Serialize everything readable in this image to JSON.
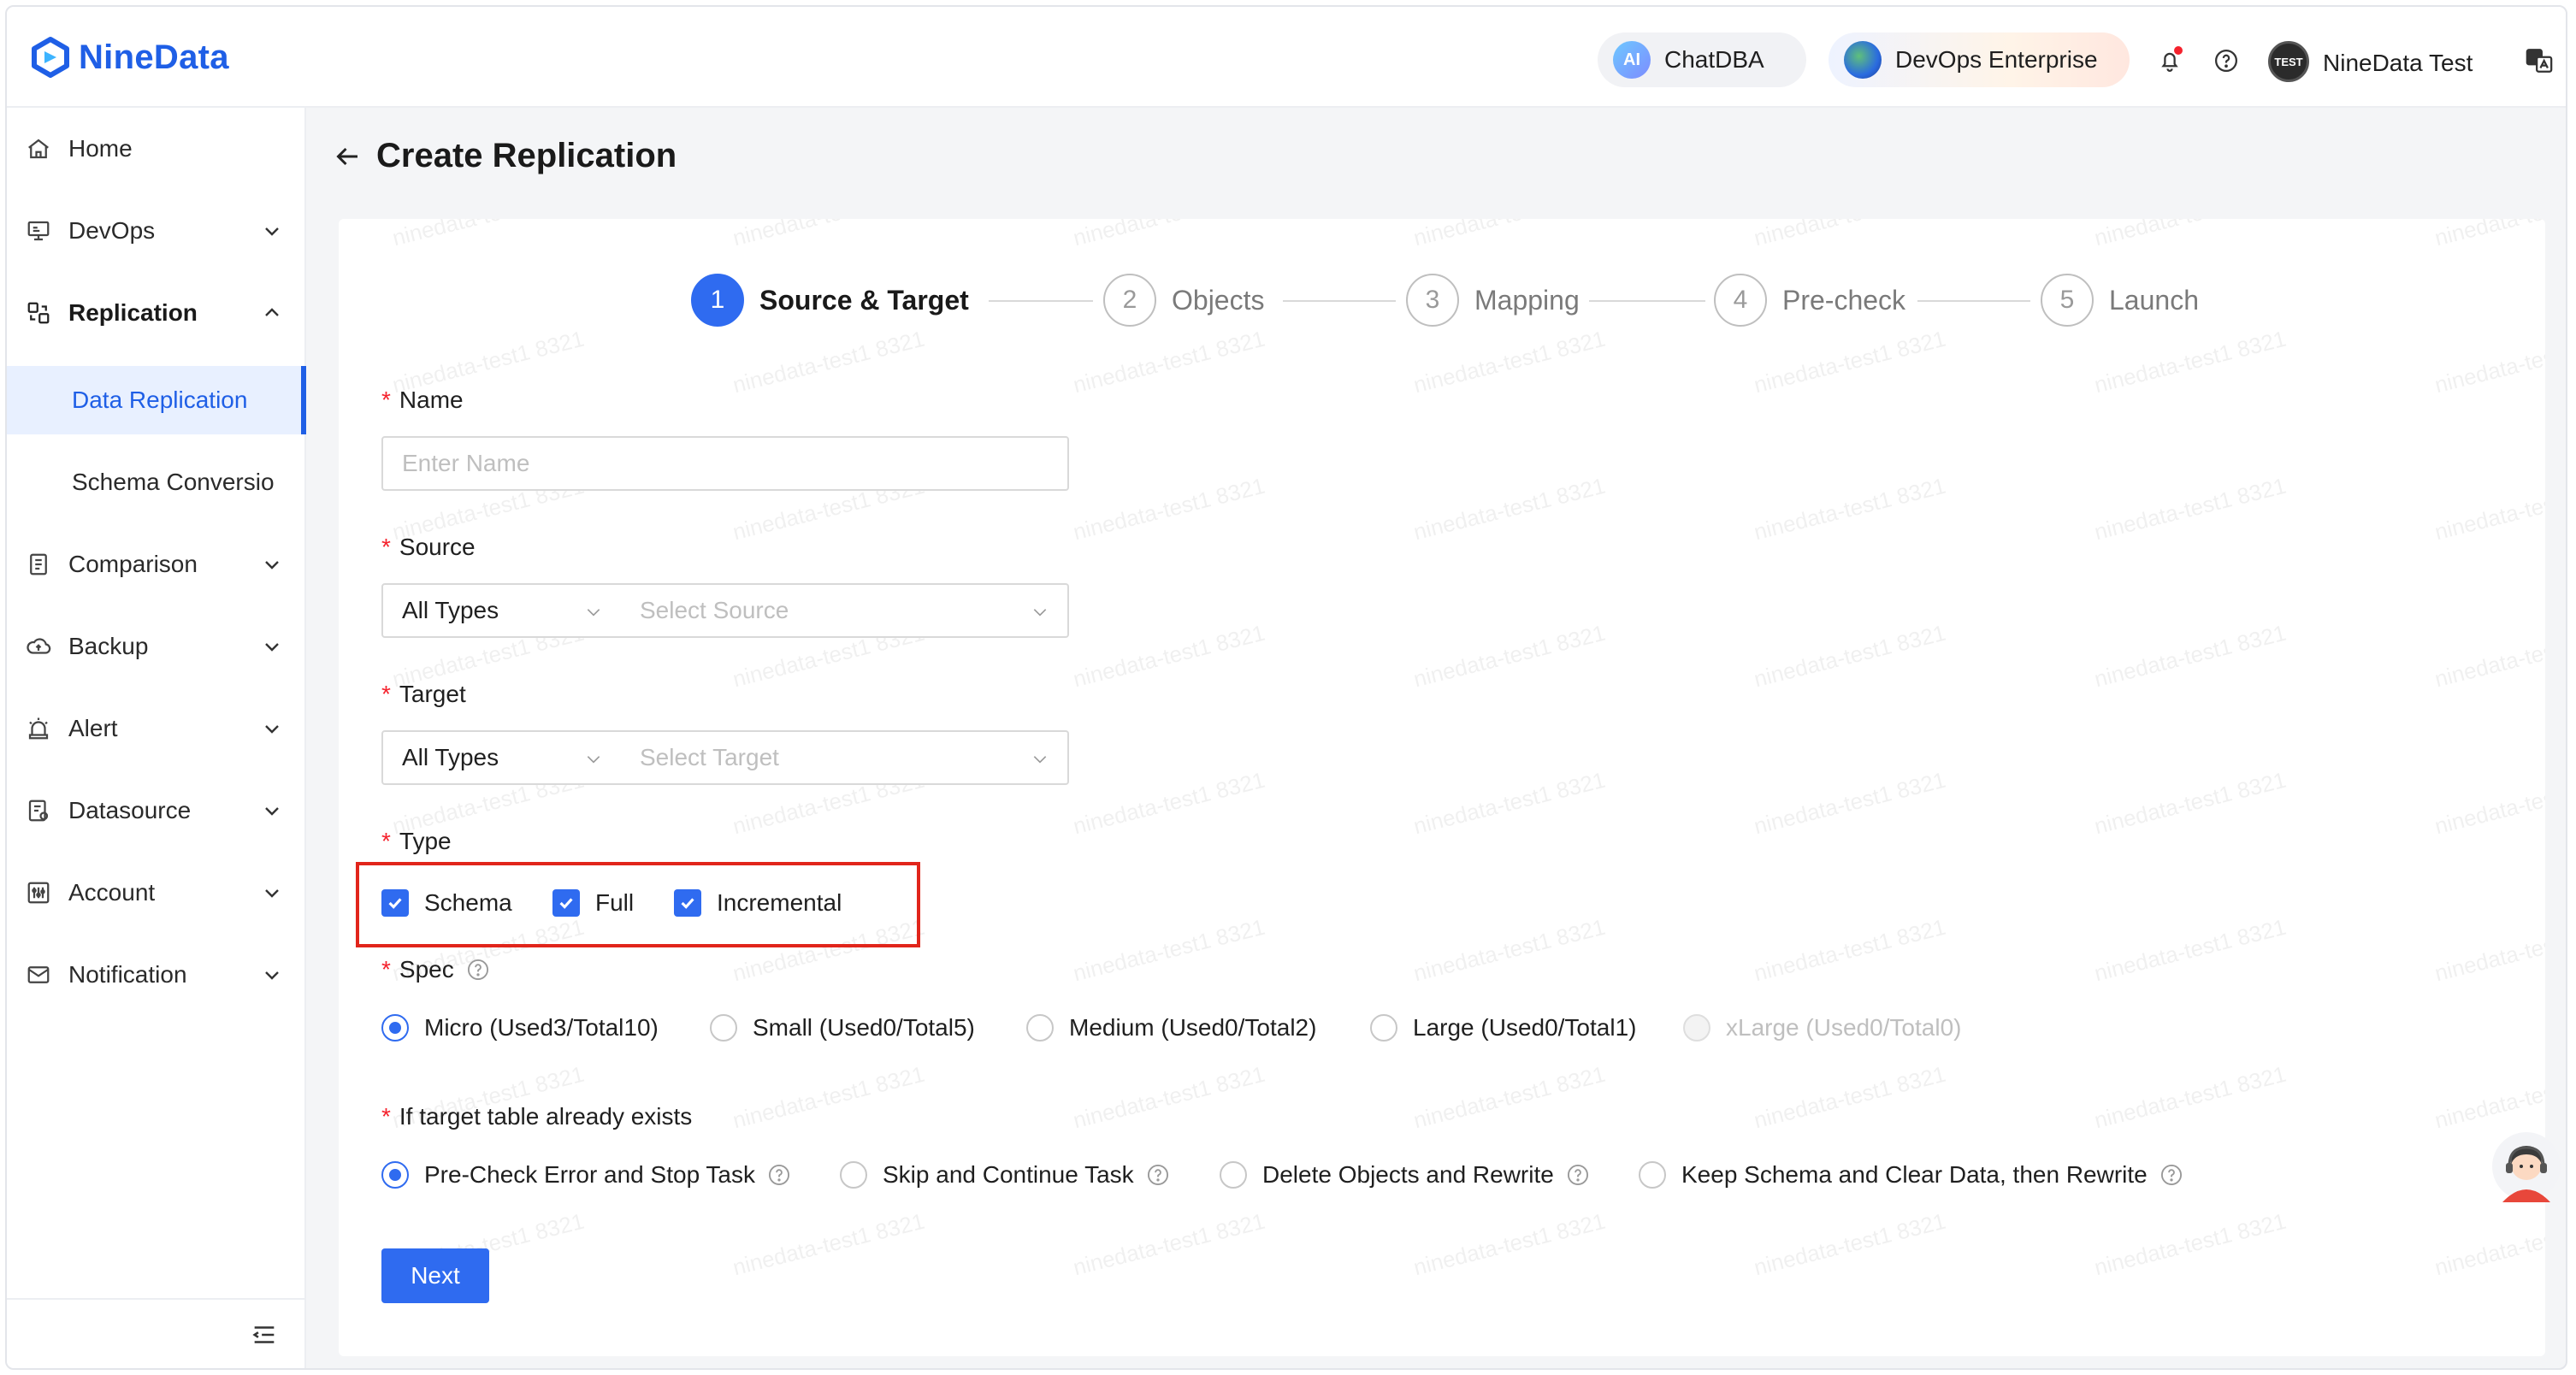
{
  "header": {
    "brand": "NineData",
    "chatdba_label": "ChatDBA",
    "chatdba_icon": "AI",
    "devops_label": "DevOps Enterprise",
    "avatar_text": "TEST",
    "username": "NineData Test"
  },
  "sidebar": {
    "items": [
      {
        "label": "Home",
        "icon": "home-icon"
      },
      {
        "label": "DevOps",
        "icon": "devops-icon"
      },
      {
        "label": "Replication",
        "icon": "replication-icon"
      },
      {
        "label": "Comparison",
        "icon": "comparison-icon"
      },
      {
        "label": "Backup",
        "icon": "backup-icon"
      },
      {
        "label": "Alert",
        "icon": "alert-icon"
      },
      {
        "label": "Datasource",
        "icon": "datasource-icon"
      },
      {
        "label": "Account",
        "icon": "account-icon"
      },
      {
        "label": "Notification",
        "icon": "notification-icon"
      }
    ],
    "sub_items": [
      {
        "label": "Data Replication",
        "active": true
      },
      {
        "label": "Schema Conversio",
        "active": false
      }
    ]
  },
  "page": {
    "title": "Create Replication",
    "watermark": "ninedata-test1 8321"
  },
  "steps": [
    {
      "num": "1",
      "label": "Source & Target",
      "active": true
    },
    {
      "num": "2",
      "label": "Objects",
      "active": false
    },
    {
      "num": "3",
      "label": "Mapping",
      "active": false
    },
    {
      "num": "4",
      "label": "Pre-check",
      "active": false
    },
    {
      "num": "5",
      "label": "Launch",
      "active": false
    }
  ],
  "form": {
    "required_mark": "*",
    "name_label": "Name",
    "name_placeholder": "Enter Name",
    "source_label": "Source",
    "source_type": "All Types",
    "source_placeholder": "Select Source",
    "target_label": "Target",
    "target_type": "All Types",
    "target_placeholder": "Select Target",
    "type_label": "Type",
    "type_options": [
      {
        "label": "Schema",
        "checked": true
      },
      {
        "label": "Full",
        "checked": true
      },
      {
        "label": "Incremental",
        "checked": true
      }
    ],
    "spec_label": "Spec",
    "spec_options": [
      {
        "label": "Micro (Used3/Total10)",
        "selected": true
      },
      {
        "label": "Small (Used0/Total5)",
        "selected": false
      },
      {
        "label": "Medium (Used0/Total2)",
        "selected": false
      },
      {
        "label": "Large (Used0/Total1)",
        "selected": false
      },
      {
        "label": "xLarge (Used0/Total0)",
        "selected": false,
        "disabled": true
      }
    ],
    "exists_label": "If target table already exists",
    "exists_options": [
      {
        "label": "Pre-Check Error and Stop Task",
        "selected": true
      },
      {
        "label": "Skip and Continue Task",
        "selected": false
      },
      {
        "label": "Delete Objects and Rewrite",
        "selected": false
      },
      {
        "label": "Keep Schema and Clear Data, then Rewrite",
        "selected": false
      }
    ],
    "next_label": "Next"
  },
  "colors": {
    "primary": "#2f6bf0",
    "brand": "#1f5fe6",
    "highlight": "#e1251b",
    "required": "#f5222d"
  }
}
